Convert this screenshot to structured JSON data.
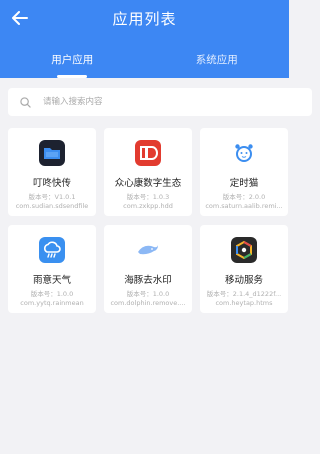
{
  "header": {
    "title": "应用列表",
    "back_icon": "arrow-left-icon",
    "background": "#3d87f3"
  },
  "tabs": [
    {
      "label": "用户应用",
      "active": true
    },
    {
      "label": "系统应用",
      "active": false
    }
  ],
  "search": {
    "placeholder": "请输入搜索内容",
    "value": "",
    "icon": "search-icon"
  },
  "apps": [
    {
      "name": "叮咚快传",
      "version": "版本号：V1.0.1",
      "package": "com.sudian.sdsendfile",
      "icon": "folder-icon",
      "color": "#1d2230"
    },
    {
      "name": "众心康数字生态",
      "version": "版本号：1.0.3",
      "package": "com.zxkpp.hdd",
      "icon": "brand-logo-icon",
      "color": "#e23b2f"
    },
    {
      "name": "定时猫",
      "version": "版本号：2.0.0",
      "package": "com.saturn.aalib.remi...",
      "icon": "alarm-cat-icon",
      "color": "#3c8ef0"
    },
    {
      "name": "雨意天气",
      "version": "版本号：1.0.0",
      "package": "com.yytq.rainmean",
      "icon": "cloud-rain-icon",
      "color": "#3a90f0"
    },
    {
      "name": "海豚去水印",
      "version": "版本号：1.0.0",
      "package": "com.dolphin.remove....",
      "icon": "dolphin-icon",
      "color": "#5a9cf0"
    },
    {
      "name": "移动服务",
      "version": "版本号：2.1.4_d1222f...",
      "package": "com.heytap.htms",
      "icon": "hexagon-icon",
      "color": "#2a2a2a"
    }
  ]
}
